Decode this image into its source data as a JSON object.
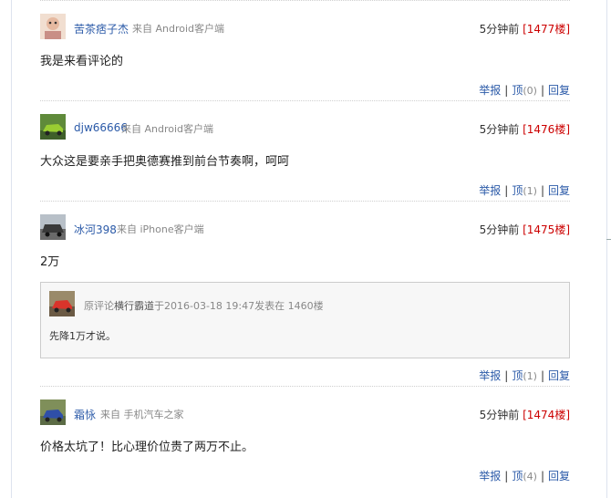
{
  "colors": {
    "link": "#2b5aa8",
    "floor": "#cc0000",
    "meta": "#888888"
  },
  "actions": {
    "report": "举报",
    "up": "顶",
    "reply": "回复"
  },
  "comments": [
    {
      "user": "苦茶痞子杰",
      "source": "来自 Android客户端",
      "time": "5分钟前",
      "floor": "[1477楼]",
      "text": "我是来看评论的",
      "up_count": "(0)",
      "avatar": "cartoon-avatar"
    },
    {
      "user": "djw66666",
      "source": "来自 Android客户端",
      "time": "5分钟前",
      "floor": "[1476楼]",
      "text": "大众这是要亲手把奥德赛推到前台节奏啊，呵呵",
      "up_count": "(1)",
      "avatar": "green-car-avatar"
    },
    {
      "user": "冰河398",
      "source": "来自 iPhone客户端",
      "time": "5分钟前",
      "floor": "[1475楼]",
      "text": "2万",
      "up_count": "(1)",
      "avatar": "jeep-avatar",
      "quote": {
        "prefix": "原评论",
        "user": "横行霸道",
        "mid": "于2016-03-18 19:47发表在 1460楼",
        "text": "先降1万才说。",
        "avatar": "red-car-avatar"
      }
    },
    {
      "user": "霜怺",
      "source": "来自 手机汽车之家",
      "time": "5分钟前",
      "floor": "[1474楼]",
      "text": "价格太坑了！比心理价位贵了两万不止。",
      "up_count": "(4)",
      "avatar": "blue-car-avatar"
    }
  ]
}
